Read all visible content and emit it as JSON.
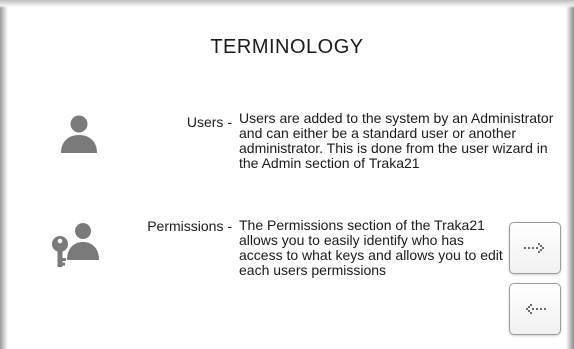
{
  "page": {
    "title": "TERMINOLOGY"
  },
  "terms": [
    {
      "label": "Users -",
      "description": "Users are added to the system by an Administrator and can either be a standard user or another administrator. This is done from the user wizard in the Admin section of Traka21",
      "icon": "user-icon"
    },
    {
      "label": "Permissions -",
      "description": "The Permissions section of the Traka21 allows you to easily identify who has access to what keys and allows you to edit each users permissions",
      "icon": "user-key-icon"
    }
  ],
  "navigation": {
    "next_icon": "dotted-arrow-right-icon",
    "prev_icon": "dotted-arrow-left-icon"
  },
  "colors": {
    "icon": "#7a7a7a",
    "text": "#1a1a1a",
    "button_border": "#9c9c9c"
  }
}
